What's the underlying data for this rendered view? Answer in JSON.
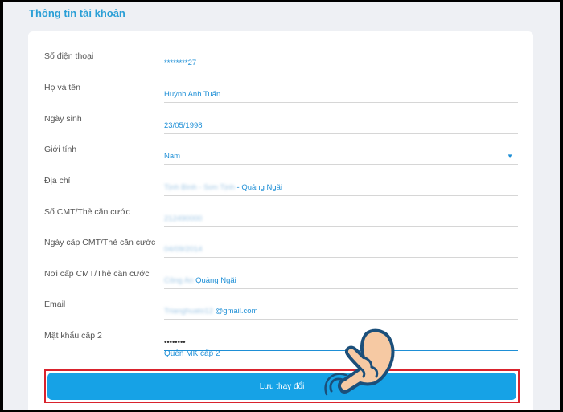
{
  "header": {
    "title": "Thông tin tài khoản"
  },
  "form": {
    "phone": {
      "label": "Số điện thoại",
      "value": "********27"
    },
    "full_name": {
      "label": "Họ và tên",
      "value": "Huỳnh Anh Tuấn"
    },
    "birthday": {
      "label": "Ngày sinh",
      "value": "23/05/1998"
    },
    "gender": {
      "label": "Giới tính",
      "value": "Nam",
      "arrow_icon": "caret-down-icon"
    },
    "address": {
      "label": "Địa chỉ",
      "value_blurred": "Tịnh Bình - Sơn Tịnh",
      "value": "- Quảng Ngãi"
    },
    "id_number": {
      "label": "Số CMT/Thẻ căn cước",
      "value_blurred": "212490000"
    },
    "id_issue_date": {
      "label": "Ngày cấp CMT/Thẻ căn cước",
      "value_blurred": "04/09/2014"
    },
    "id_issue_place": {
      "label": "Nơi cấp CMT/Thẻ căn cước",
      "value_blurred": "Công An",
      "value": "Quảng Ngãi"
    },
    "email": {
      "label": "Email",
      "value_blurred": "Trianghuato12",
      "value": "@gmail.com"
    },
    "password2": {
      "label": "Mật khẩu cấp 2",
      "value": "••••••••"
    },
    "forgot_link": "Quên MK cấp 2",
    "save_label": "Lưu thay đổi"
  },
  "colors": {
    "accent": "#1e8fd6",
    "button": "#16a2e6",
    "highlight_frame": "#d9232d",
    "background": "#eef0f4"
  },
  "icons": {
    "pointer": "pointing-hand-icon"
  }
}
